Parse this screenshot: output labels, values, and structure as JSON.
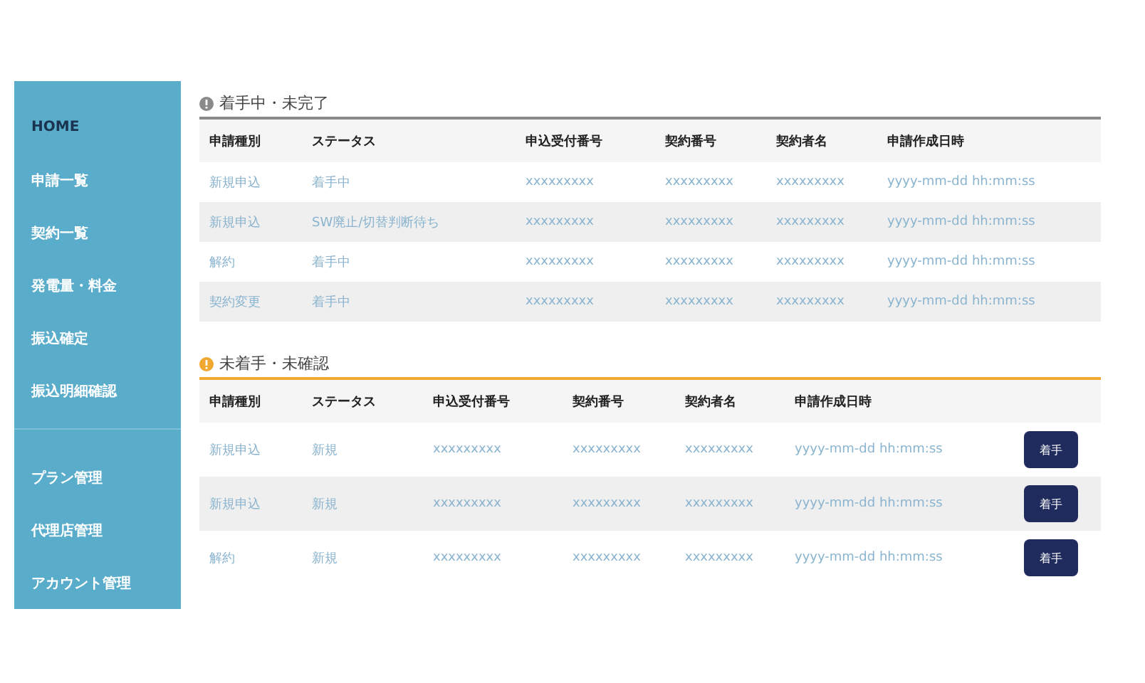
{
  "sidebar": {
    "groups": [
      {
        "items": [
          {
            "label": "HOME",
            "selected": true
          },
          {
            "label": "申請一覧",
            "selected": false
          },
          {
            "label": "契約一覧",
            "selected": false
          },
          {
            "label": "発電量・料金",
            "selected": false
          },
          {
            "label": "振込確定",
            "selected": false
          },
          {
            "label": "振込明細確認",
            "selected": false
          }
        ]
      },
      {
        "items": [
          {
            "label": "プラン管理",
            "selected": false
          },
          {
            "label": "代理店管理",
            "selected": false
          },
          {
            "label": "アカウント管理",
            "selected": false
          }
        ]
      }
    ]
  },
  "sections": [
    {
      "title": "着手中・未完了",
      "kind": "in_progress",
      "columns": [
        "申請種別",
        "ステータス",
        "申込受付番号",
        "契約番号",
        "契約者名",
        "申請作成日時"
      ],
      "rows": [
        {
          "cells": [
            "新規申込",
            "着手中",
            "xxxxxxxxx",
            "xxxxxxxxx",
            "xxxxxxxxx",
            "yyyy-mm-dd hh:mm:ss"
          ]
        },
        {
          "cells": [
            "新規申込",
            "SW廃止/切替判断待ち",
            "xxxxxxxxx",
            "xxxxxxxxx",
            "xxxxxxxxx",
            "yyyy-mm-dd hh:mm:ss"
          ]
        },
        {
          "cells": [
            "解約",
            "着手中",
            "xxxxxxxxx",
            "xxxxxxxxx",
            "xxxxxxxxx",
            "yyyy-mm-dd hh:mm:ss"
          ]
        },
        {
          "cells": [
            "契約変更",
            "着手中",
            "xxxxxxxxx",
            "xxxxxxxxx",
            "xxxxxxxxx",
            "yyyy-mm-dd hh:mm:ss"
          ]
        }
      ]
    },
    {
      "title": "未着手・未確認",
      "kind": "not_started",
      "columns": [
        "申請種別",
        "ステータス",
        "申込受付番号",
        "契約番号",
        "契約者名",
        "申請作成日時"
      ],
      "rows": [
        {
          "cells": [
            "新規申込",
            "新規",
            "xxxxxxxxx",
            "xxxxxxxxx",
            "xxxxxxxxx",
            "yyyy-mm-dd hh:mm:ss"
          ],
          "button": "着手"
        },
        {
          "cells": [
            "新規申込",
            "新規",
            "xxxxxxxxx",
            "xxxxxxxxx",
            "xxxxxxxxx",
            "yyyy-mm-dd hh:mm:ss"
          ],
          "button": "着手"
        },
        {
          "cells": [
            "解約",
            "新規",
            "xxxxxxxxx",
            "xxxxxxxxx",
            "xxxxxxxxx",
            "yyyy-mm-dd hh:mm:ss"
          ],
          "button": "着手"
        }
      ]
    }
  ]
}
